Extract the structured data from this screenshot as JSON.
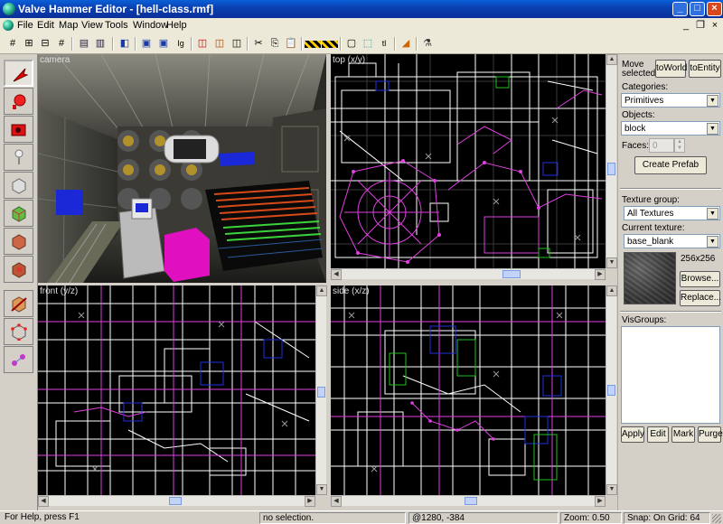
{
  "window": {
    "title": "Valve Hammer Editor - [hell-class.rmf]",
    "min": "_",
    "max": "□",
    "close": "×"
  },
  "menu": [
    "File",
    "Edit",
    "Map",
    "View",
    "Tools",
    "Window",
    "Help"
  ],
  "mdi_controls": {
    "min": "_",
    "restore": "❐",
    "close": "×"
  },
  "toolbar_icons": [
    "grid-icon",
    "grid-small-icon",
    "grid-large-icon",
    "grid-plus-icon",
    "carve-icon",
    "hollow-icon",
    "group-icon",
    "ungroup-icon",
    "hide-icon",
    "show-icon",
    "ignore-groups-icon",
    "texture-lock-icon",
    "brush-icon",
    "cube-icon",
    "cut-icon",
    "copy-icon",
    "paste-icon",
    "hatch-icon",
    "hatch-alt-icon",
    "select-box-icon",
    "select-icon",
    "tl-icon",
    "run-map-icon",
    "entity-report-icon"
  ],
  "left_tools": [
    "selection-tool",
    "magnify-tool",
    "camera-tool",
    "entity-tool",
    "block-tool",
    "texture-tool",
    "apply-texture-tool",
    "decal-tool",
    "clip-tool",
    "vertex-tool",
    "path-tool"
  ],
  "viewports": {
    "camera": "camera",
    "top": "top (x/y)",
    "front": "front (y/z)",
    "side": "side (x/z)"
  },
  "panel": {
    "move_selected_label": "Move selected:",
    "to_world": "toWorld",
    "to_entity": "toEntity",
    "categories_label": "Categories:",
    "categories_value": "Primitives",
    "objects_label": "Objects:",
    "objects_value": "block",
    "faces_label": "Faces:",
    "faces_value": "0",
    "create_prefab": "Create Prefab",
    "texture_group_label": "Texture group:",
    "texture_group_value": "All Textures",
    "current_texture_label": "Current texture:",
    "current_texture_value": "base_blank",
    "texture_size": "256x256",
    "browse": "Browse...",
    "replace": "Replace...",
    "visgroups_label": "VisGroups:",
    "apply": "Apply",
    "edit": "Edit",
    "mark": "Mark",
    "purge": "Purge"
  },
  "status": {
    "help": "For Help, press F1",
    "selection": "no selection.",
    "coords": "@1280, -384",
    "zoom": "Zoom: 0.50",
    "snap": "Snap: On Grid: 64"
  },
  "colors": {
    "title_blue": "#0a3fb0",
    "wire_white": "#ffffff",
    "wire_magenta": "#e040e0",
    "brush_blue": "#1a28d8",
    "brush_magenta": "#e010c0"
  }
}
